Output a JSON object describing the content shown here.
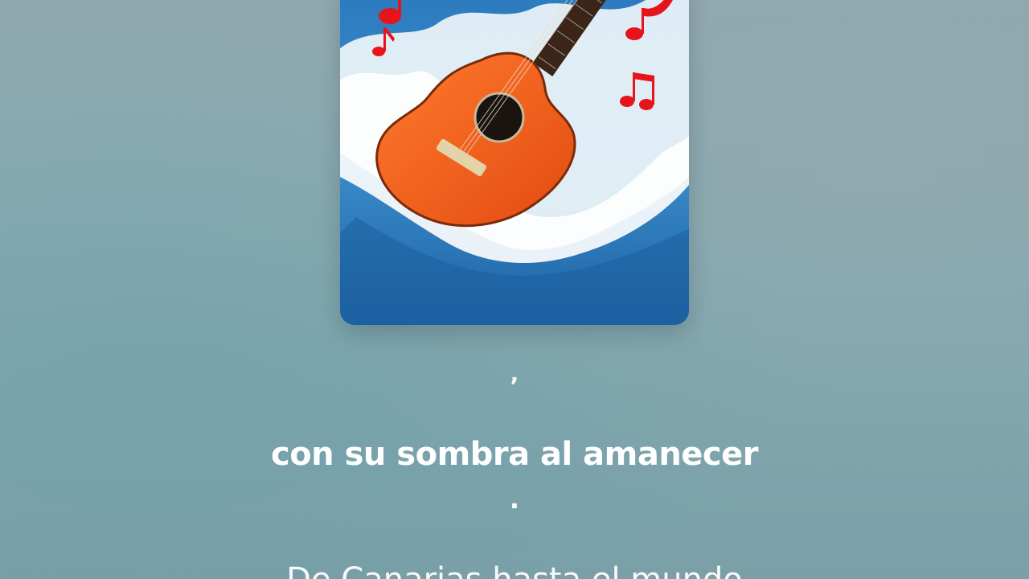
{
  "album_art": {
    "icon": "guitar-in-wave-artwork",
    "colors": {
      "sea": "#1f6fb0",
      "foam": "#f4f8fb",
      "guitar_body": "#f05a1a",
      "notes": "#e8141c"
    }
  },
  "lyrics": {
    "previous": ",",
    "current": "con su sombra al amanecer",
    "separator": ".",
    "next": "De Canarias hasta el mundo"
  }
}
